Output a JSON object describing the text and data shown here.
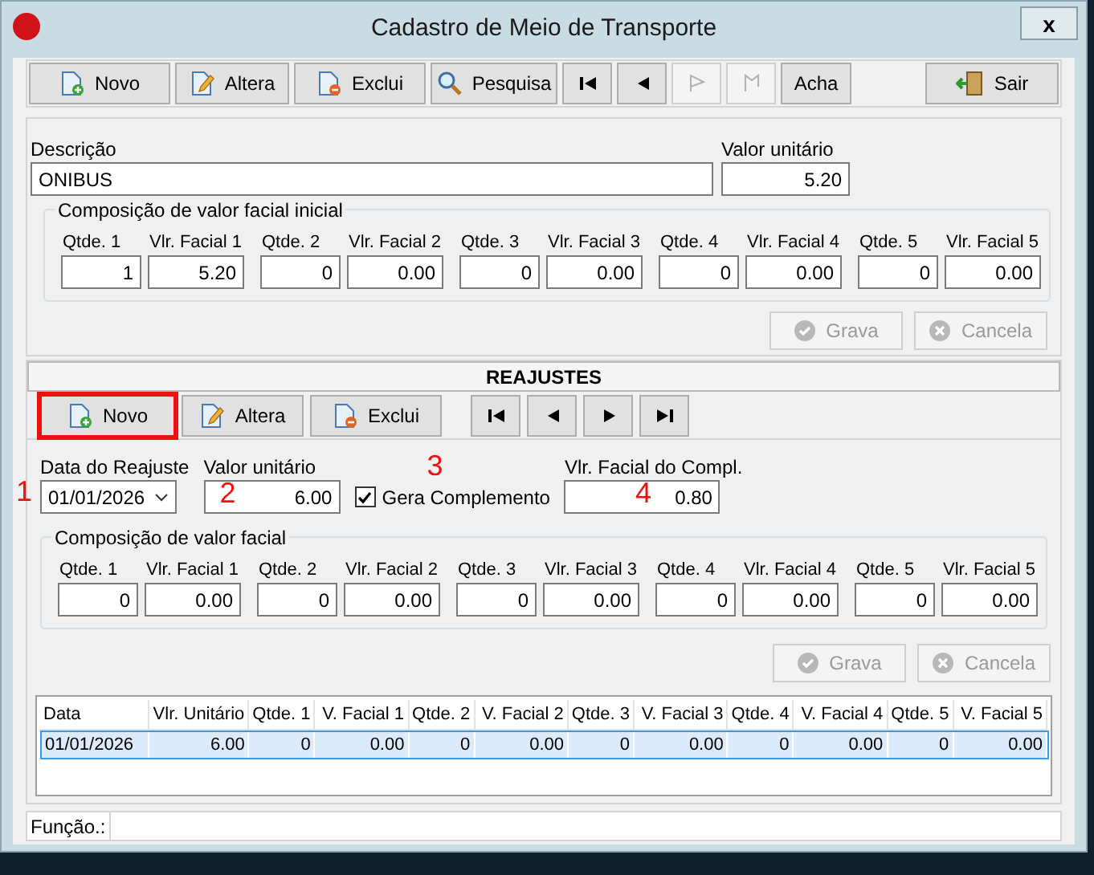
{
  "window": {
    "title": "Cadastro de Meio de Transporte",
    "close": "x"
  },
  "toolbar": [
    {
      "kind": "text",
      "label": "Novo",
      "disabled": false
    },
    {
      "kind": "text",
      "label": "Altera",
      "disabled": false
    },
    {
      "kind": "text",
      "label": "Exclui",
      "disabled": false
    },
    {
      "kind": "text",
      "label": "Pesquisa",
      "disabled": false
    },
    {
      "kind": "nav",
      "disabled": false
    },
    {
      "kind": "nav",
      "disabled": false
    },
    {
      "kind": "nav",
      "disabled": true
    },
    {
      "kind": "nav",
      "disabled": true
    },
    {
      "kind": "text",
      "label": "Acha",
      "disabled": false
    },
    {
      "kind": "exit",
      "label": "Sair",
      "disabled": false
    }
  ],
  "main": {
    "description_label": "Descrição",
    "description": "ONIBUS",
    "unit_label": "Valor unitário",
    "unit_value": "5.20",
    "group": {
      "title": "Composição de valor facial inicial",
      "fields": [
        {
          "label": "Qtde. 1",
          "value": "1"
        },
        {
          "label": "Vlr. Facial 1",
          "value": "5.20"
        },
        {
          "label": "Qtde. 2",
          "value": "0"
        },
        {
          "label": "Vlr. Facial 2",
          "value": "0.00"
        },
        {
          "label": "Qtde. 3",
          "value": "0"
        },
        {
          "label": "Vlr. Facial 3",
          "value": "0.00"
        },
        {
          "label": "Qtde. 4",
          "value": "0"
        },
        {
          "label": "Vlr. Facial 4",
          "value": "0.00"
        },
        {
          "label": "Qtde. 5",
          "value": "0"
        },
        {
          "label": "Vlr. Facial 5",
          "value": "0.00"
        }
      ]
    },
    "actions": [
      {
        "label": "Grava",
        "disabled": true
      },
      {
        "label": "Cancela",
        "disabled": true
      }
    ]
  },
  "reajustes": {
    "title": "REAJUSTES",
    "toolbar": [
      {
        "kind": "text",
        "label": "Novo",
        "highlighted": true
      },
      {
        "kind": "text",
        "label": "Altera",
        "highlighted": false
      },
      {
        "kind": "text",
        "label": "Exclui",
        "highlighted": false
      },
      {
        "kind": "nav",
        "highlighted": false
      },
      {
        "kind": "nav",
        "highlighted": false
      },
      {
        "kind": "nav",
        "highlighted": false
      },
      {
        "kind": "nav",
        "highlighted": false
      }
    ],
    "date_label": "Data do Reajuste",
    "date": "01/01/2026",
    "unit_label": "Valor unitário",
    "unit_value": "6.00",
    "checkbox": {
      "label": "Gera Complemento",
      "checked": true
    },
    "compl_label": "Vlr. Facial do Compl.",
    "compl_value": "0.80",
    "markers": [
      "1",
      "2",
      "3",
      "4"
    ],
    "group": {
      "title": "Composição de valor facial",
      "fields": [
        {
          "label": "Qtde. 1",
          "value": "0"
        },
        {
          "label": "Vlr. Facial 1",
          "value": "0.00"
        },
        {
          "label": "Qtde. 2",
          "value": "0"
        },
        {
          "label": "Vlr. Facial 2",
          "value": "0.00"
        },
        {
          "label": "Qtde. 3",
          "value": "0"
        },
        {
          "label": "Vlr. Facial 3",
          "value": "0.00"
        },
        {
          "label": "Qtde. 4",
          "value": "0"
        },
        {
          "label": "Vlr. Facial 4",
          "value": "0.00"
        },
        {
          "label": "Qtde. 5",
          "value": "0"
        },
        {
          "label": "Vlr. Facial 5",
          "value": "0.00"
        }
      ]
    },
    "actions": [
      {
        "label": "Grava",
        "disabled": true
      },
      {
        "label": "Cancela",
        "disabled": true
      }
    ],
    "table": {
      "columns": [
        {
          "kind": "date",
          "label": "Data"
        },
        {
          "kind": "money",
          "label": "Vlr. Unitário"
        },
        {
          "kind": "qty",
          "label": "Qtde. 1"
        },
        {
          "kind": "money",
          "label": "V. Facial 1"
        },
        {
          "kind": "qty",
          "label": "Qtde. 2"
        },
        {
          "kind": "money",
          "label": "V. Facial 2"
        },
        {
          "kind": "qty",
          "label": "Qtde. 3"
        },
        {
          "kind": "money",
          "label": "V. Facial 3"
        },
        {
          "kind": "qty",
          "label": "Qtde. 4"
        },
        {
          "kind": "money",
          "label": "V. Facial 4"
        },
        {
          "kind": "qty",
          "label": "Qtde. 5"
        },
        {
          "kind": "money",
          "label": "V. Facial 5"
        }
      ],
      "rows": [
        {
          "selected": true,
          "cells": [
            "01/01/2026",
            "6.00",
            "0",
            "0.00",
            "0",
            "0.00",
            "0",
            "0.00",
            "0",
            "0.00",
            "0",
            "0.00"
          ]
        }
      ]
    }
  },
  "status_bar": {
    "label": "Função.:"
  }
}
